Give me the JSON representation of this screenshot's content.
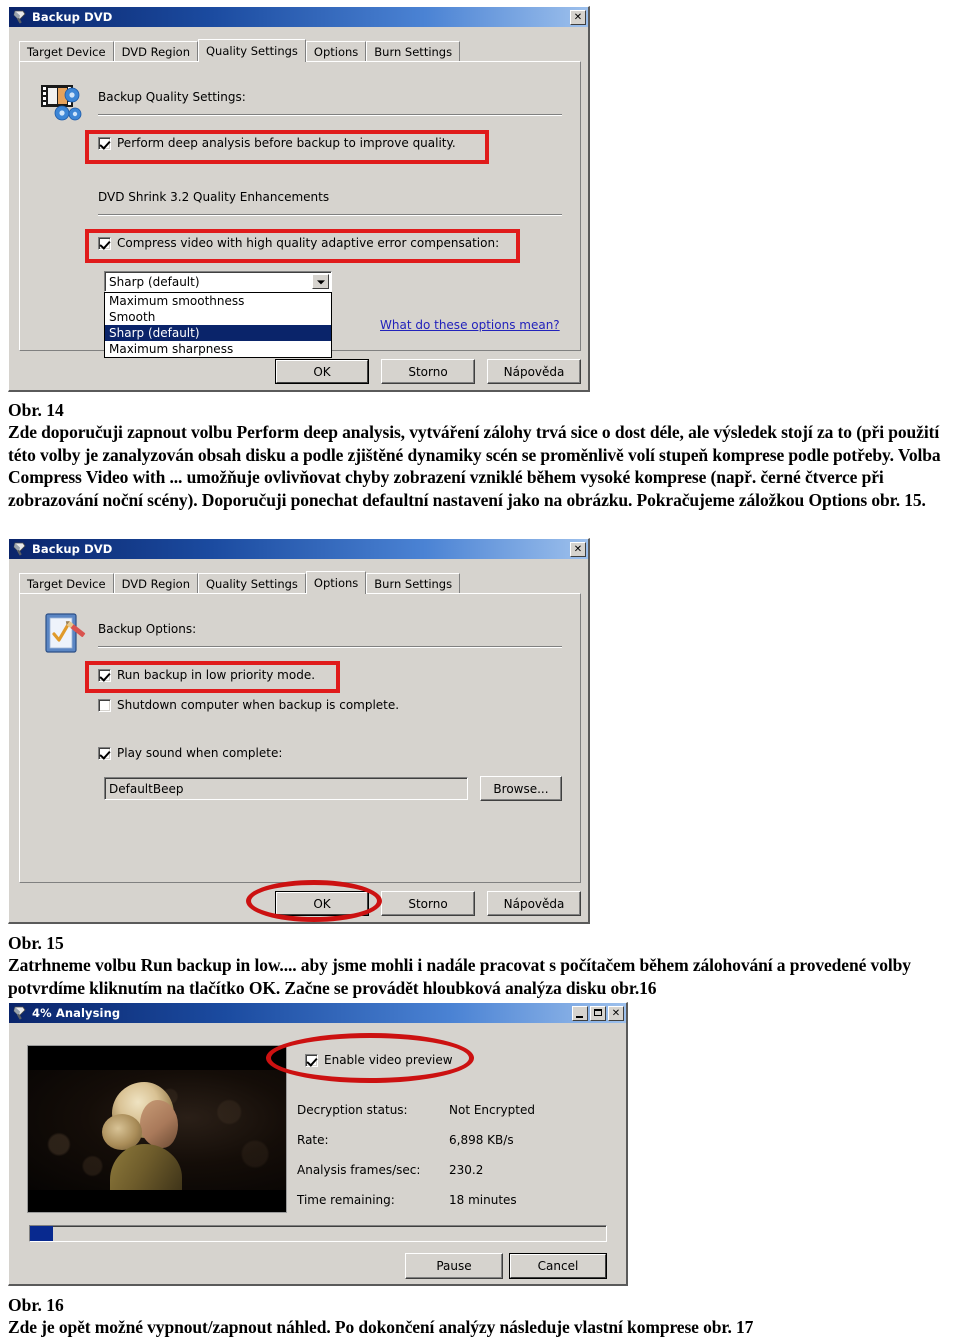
{
  "document": {
    "figures": [
      {
        "caption_label": "Obr. 14",
        "body": "Zde doporučuji zapnout volbu Perform deep analysis, vytváření zálohy trvá sice o dost déle, ale výsledek stojí za to (při použití této volby je zanalyzován obsah disku a podle zjištěné dynamiky scén se proměnlivě volí stupeň komprese podle potřeby. Volba Compress Video with ... umožňuje ovlivňovat chyby zobrazení vzniklé během vysoké komprese (např. černé čtverce při zobrazování noční scény). Doporučuji ponechat defaultní nastavení jako na obrázku. Pokračujeme záložkou Options obr. 15."
      },
      {
        "caption_label": "Obr. 15",
        "body": "Zatrhneme volbu Run backup in low.... aby jsme mohli i nadále pracovat s počítačem během zálohování a provedené volby potvrdíme kliknutím na tlačítko OK. Začne se provádět hloubková analýza disku obr.16"
      },
      {
        "caption_label": "Obr. 16",
        "body": "Zde je opět možné vypnout/zapnout náhled. Po dokončení analýzy následuje vlastní komprese obr. 17"
      }
    ]
  },
  "dialog_quality": {
    "title": "Backup DVD",
    "title_icon": "dvd-shrink-icon",
    "close_label": "✕",
    "tabs": [
      {
        "label": "Target Device",
        "active": false
      },
      {
        "label": "DVD Region",
        "active": false
      },
      {
        "label": "Quality Settings",
        "active": true
      },
      {
        "label": "Options",
        "active": false
      },
      {
        "label": "Burn Settings",
        "active": false
      }
    ],
    "group_heading": "Backup Quality Settings:",
    "group_icon": "film-gears-icon",
    "deep_analysis": {
      "label": "Perform deep analysis before backup to improve quality.",
      "checked": true,
      "annotated": true
    },
    "enhancements_heading": "DVD Shrink 3.2 Quality Enhancements",
    "compress_video": {
      "label": "Compress video with high quality adaptive error compensation:",
      "checked": true,
      "annotated": true
    },
    "quality_combo": {
      "value": "Sharp (default)",
      "expanded": true,
      "options": [
        "Maximum smoothness",
        "Smooth",
        "Sharp (default)",
        "Maximum sharpness"
      ],
      "selected_index": 2
    },
    "help_link": "What do these options mean?",
    "buttons": {
      "ok": "OK",
      "cancel": "Storno",
      "help": "Nápověda"
    }
  },
  "dialog_options": {
    "title": "Backup DVD",
    "title_icon": "dvd-shrink-icon",
    "close_label": "✕",
    "tabs": [
      {
        "label": "Target Device",
        "active": false
      },
      {
        "label": "DVD Region",
        "active": false
      },
      {
        "label": "Quality Settings",
        "active": false
      },
      {
        "label": "Options",
        "active": true
      },
      {
        "label": "Burn Settings",
        "active": false
      }
    ],
    "group_heading": "Backup Options:",
    "group_icon": "clipboard-check-pencil-icon",
    "low_priority": {
      "label": "Run backup in low priority mode.",
      "checked": true,
      "annotated": true
    },
    "shutdown": {
      "label": "Shutdown computer when backup is complete.",
      "checked": false,
      "annotated": false
    },
    "play_sound": {
      "label": "Play sound when complete:",
      "checked": true
    },
    "sound_value": "DefaultBeep",
    "browse_label": "Browse...",
    "buttons": {
      "ok": "OK",
      "cancel": "Storno",
      "help": "Nápověda"
    },
    "ok_annotated": true
  },
  "dialog_analysing": {
    "title": "4% Analysing",
    "title_icon": "dvd-shrink-icon",
    "minimize_label": "",
    "maximize_label": "",
    "close_label": "✕",
    "enable_preview": {
      "label": "Enable video preview",
      "checked": true,
      "annotated": true
    },
    "stats": [
      {
        "label": "Decryption status:",
        "value": "Not Encrypted"
      },
      {
        "label": "Rate:",
        "value": "6,898 KB/s"
      },
      {
        "label": "Analysis frames/sec:",
        "value": "230.2"
      },
      {
        "label": "Time remaining:",
        "value": "18 minutes"
      }
    ],
    "progress_percent": 4,
    "buttons": {
      "pause": "Pause",
      "cancel": "Cancel"
    }
  },
  "colors": {
    "dialog_face": "#d6d3ce",
    "titlebar_start": "#0a246a",
    "titlebar_end": "#9dc0ec",
    "annotation_red": "#e01b1b",
    "link_blue": "#2222bb",
    "selection_blue": "#0a246a",
    "progress_blue": "#08298f"
  }
}
